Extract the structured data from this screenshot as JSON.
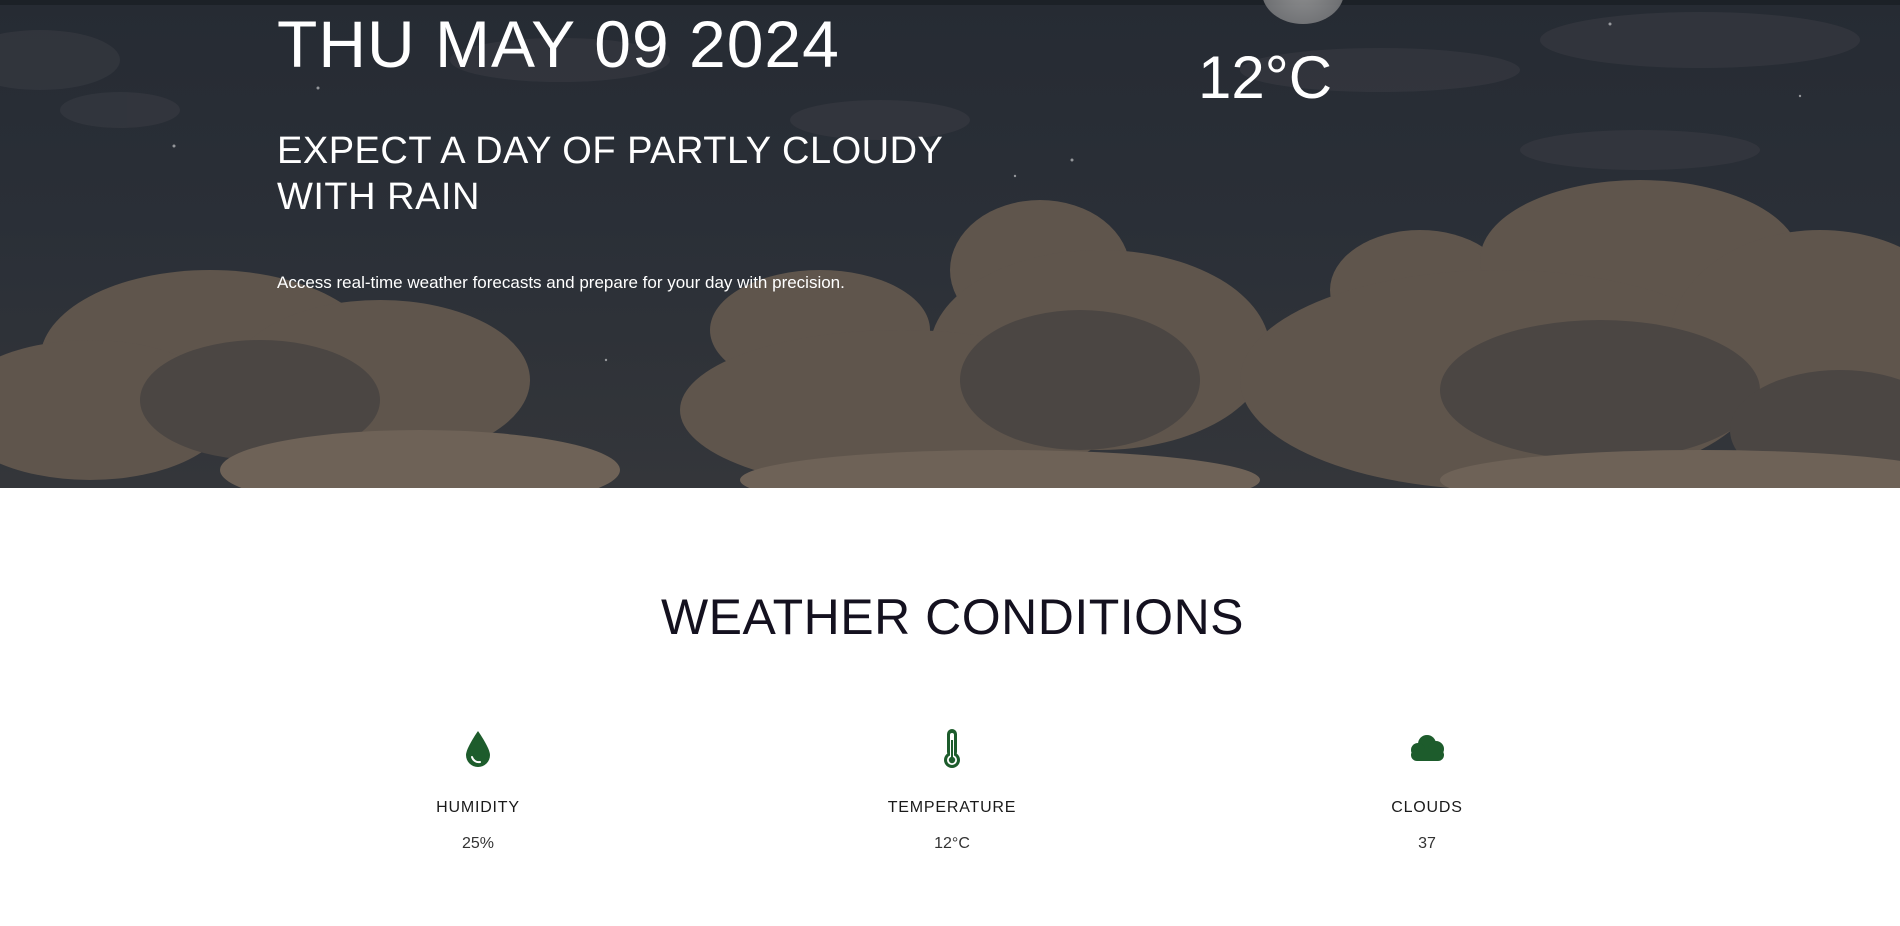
{
  "hero": {
    "date": "THU MAY 09 2024",
    "temperature": "12°C",
    "headline": "EXPECT A DAY OF PARTLY CLOUDY WITH RAIN",
    "tagline": "Access real-time weather forecasts and prepare for your day with precision."
  },
  "conditions": {
    "title": "WEATHER CONDITIONS",
    "items": [
      {
        "icon": "water-drop-icon",
        "label": "HUMIDITY",
        "value": "25%"
      },
      {
        "icon": "thermometer-icon",
        "label": "TEMPERATURE",
        "value": "12°C"
      },
      {
        "icon": "cloud-icon",
        "label": "CLOUDS",
        "value": "37"
      }
    ]
  },
  "colors": {
    "hero_sky": "#262b33",
    "cloud": "#6b5f54",
    "icon_green": "#1d5c2c",
    "heading": "#14111f"
  }
}
